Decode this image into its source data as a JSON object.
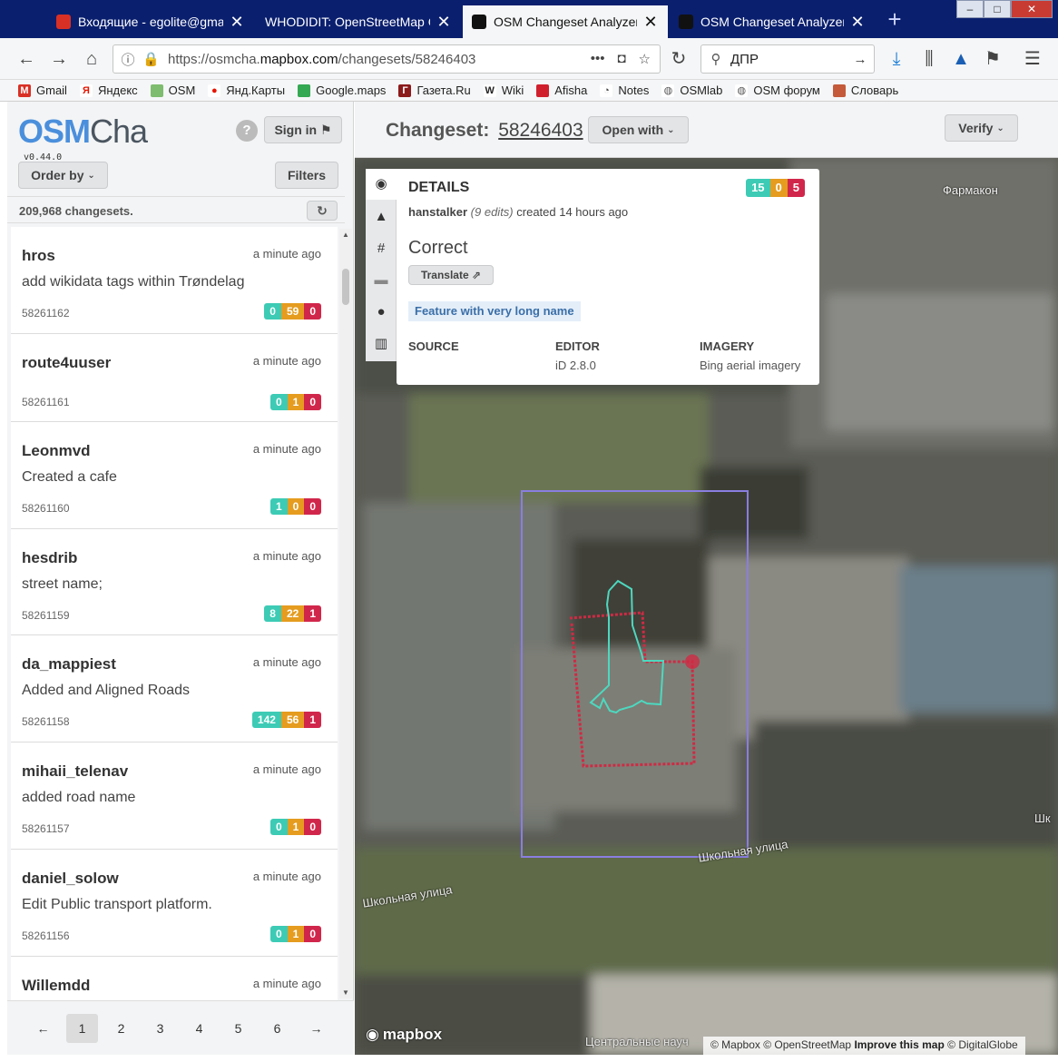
{
  "browser": {
    "tabs": [
      {
        "label": "Входящие - egolite@gmail.",
        "active": false
      },
      {
        "label": "WHODIDIT: OpenStreetMap Cha",
        "active": false
      },
      {
        "label": "OSM Changeset Analyzer",
        "active": true
      },
      {
        "label": "OSM Changeset Analyzer",
        "active": false
      }
    ],
    "url_prefix": "https://osmcha.",
    "url_domain": "mapbox.com",
    "url_path": "/changesets/58246403",
    "search_text": "ДПР",
    "bookmarks": [
      "Gmail",
      "Яндекс",
      "OSM",
      "Янд.Карты",
      "Google.maps",
      "Газета.Ru",
      "Wiki",
      "Afisha",
      "Notes",
      "OSMlab",
      "OSM форум",
      "Словарь"
    ]
  },
  "sidebar": {
    "brand_a": "OSM",
    "brand_b": "Cha",
    "version": "v0.44.0",
    "help": "?",
    "sign_in": "Sign in",
    "order_by": "Order by",
    "filters": "Filters",
    "count": "209,968 changesets.",
    "items": [
      {
        "user": "hros",
        "time": "a minute ago",
        "comment": "add wikidata tags within Trøndelag",
        "id": "58261162",
        "create": "0",
        "modify": "59",
        "delete": "0"
      },
      {
        "user": "route4uuser",
        "time": "a minute ago",
        "comment": "",
        "id": "58261161",
        "create": "0",
        "modify": "1",
        "delete": "0"
      },
      {
        "user": "Leonmvd",
        "time": "a minute ago",
        "comment": "Created a cafe",
        "id": "58261160",
        "create": "1",
        "modify": "0",
        "delete": "0"
      },
      {
        "user": "hesdrib",
        "time": "a minute ago",
        "comment": "street name;",
        "id": "58261159",
        "create": "8",
        "modify": "22",
        "delete": "1"
      },
      {
        "user": "da_mappiest",
        "time": "a minute ago",
        "comment": "Added and Aligned Roads",
        "id": "58261158",
        "create": "142",
        "modify": "56",
        "delete": "1"
      },
      {
        "user": "mihaii_telenav",
        "time": "a minute ago",
        "comment": "added road name",
        "id": "58261157",
        "create": "0",
        "modify": "1",
        "delete": "0"
      },
      {
        "user": "daniel_solow",
        "time": "a minute ago",
        "comment": "Edit Public transport platform.",
        "id": "58261156",
        "create": "0",
        "modify": "1",
        "delete": "0"
      },
      {
        "user": "Willemdd",
        "time": "a minute ago",
        "comment": "",
        "id": "",
        "create": "",
        "modify": "",
        "delete": ""
      }
    ],
    "pages": [
      "1",
      "2",
      "3",
      "4",
      "5",
      "6"
    ],
    "prev": "←",
    "next": "→"
  },
  "main": {
    "changeset_label": "Changeset:",
    "changeset_id": "58246403",
    "open_with": "Open with",
    "verify": "Verify"
  },
  "details": {
    "title": "DETAILS",
    "create": "15",
    "modify": "0",
    "delete": "5",
    "user": "hanstalker",
    "edits": "(9 edits)",
    "created": "created 14 hours ago",
    "comment": "Correct",
    "translate": "Translate",
    "flag": "Feature with very long name",
    "source_label": "SOURCE",
    "source_value": "",
    "editor_label": "EDITOR",
    "editor_value": "iD 2.8.0",
    "imagery_label": "IMAGERY",
    "imagery_value": "Bing aerial imagery"
  },
  "map": {
    "poi": "Фармакон",
    "street1": "Школьная улица",
    "street2": "Школьная улица",
    "street3": "Центральные науч",
    "edge_label": "Шк",
    "logo": "mapbox",
    "attribution_a": "© Mapbox © OpenStreetMap",
    "attribution_b": "Improve this map",
    "attribution_c": "© DigitalGlobe"
  },
  "colors": {
    "create": "#3dcbb5",
    "modify": "#e59c1f",
    "delete": "#d1264b",
    "brand": "#4a8fdc"
  }
}
